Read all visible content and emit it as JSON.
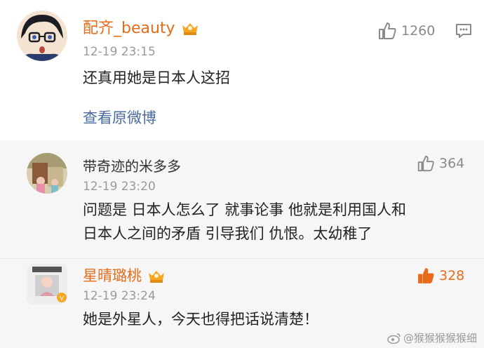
{
  "comments": [
    {
      "username": "配齐_beauty",
      "timestamp": "12-19 23:15",
      "text": "还真用她是日本人这招",
      "likes": "1260",
      "link_label": "查看原微博",
      "vip_icon": "crown-badge-icon",
      "name_color": "#e86b1a"
    },
    {
      "username": "带奇迹的米多多",
      "timestamp": "12-19 23:20",
      "text_line1": "问题是 日本人怎么了 就事论事 他就是利用国人和",
      "text_line2": "日本人之间的矛盾 引导我们 仇恨。太幼稚了",
      "likes": "364"
    },
    {
      "username": "星晴璐桃",
      "timestamp": "12-19 23:24",
      "text": "她是外星人，今天也得把话说清楚！",
      "likes": "328",
      "vip_icon": "crown-badge-icon",
      "name_color": "#e86b1a",
      "like_color": "#e86b1a"
    }
  ],
  "watermark": "@猴猴猴猴猴细"
}
